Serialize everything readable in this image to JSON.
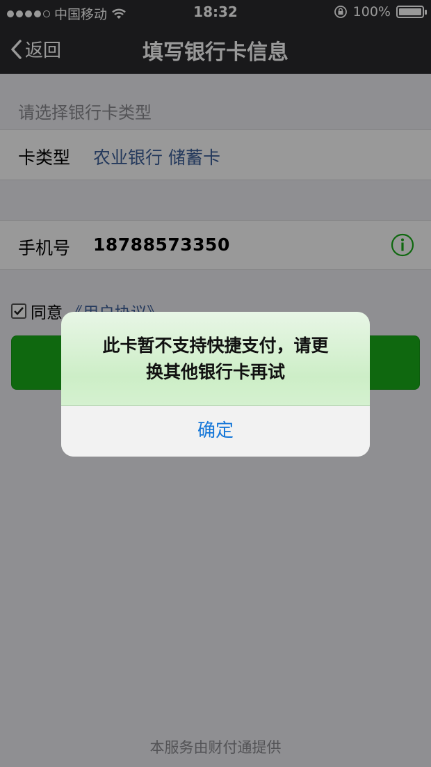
{
  "status_bar": {
    "carrier": "中国移动",
    "time": "18:32",
    "battery": "100%"
  },
  "nav": {
    "back_label": "返回",
    "title": "填写银行卡信息"
  },
  "form": {
    "section_hint": "请选择银行卡类型",
    "card_type_label": "卡类型",
    "card_type_value": "农业银行 储蓄卡",
    "phone_label": "手机号",
    "phone_value": "18788573350",
    "agree_text": "同意",
    "agreement_link": "《用户协议》"
  },
  "alert": {
    "message_line1": "此卡暂不支持快捷支付，请更",
    "message_line2": "换其他银行卡再试",
    "ok_button": "确定"
  },
  "footer": {
    "text": "本服务由财付通提供"
  },
  "colors": {
    "nav_bg": "#2b2b2d",
    "primary_green": "#1aad19",
    "link_blue": "#3c5f99",
    "alert_button_blue": "#1577d8"
  }
}
